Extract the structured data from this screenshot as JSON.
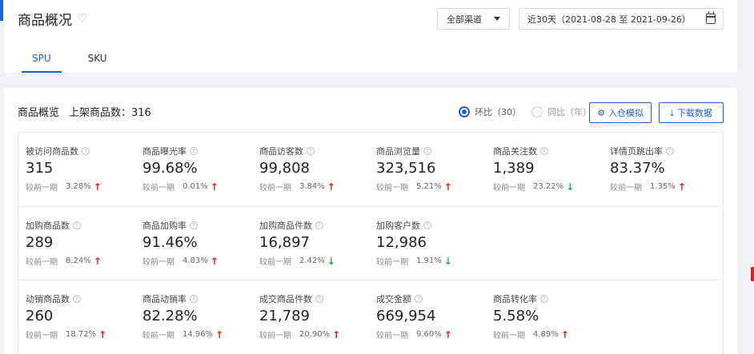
{
  "page": {
    "title": "商品概况"
  },
  "filters": {
    "channel": "全部渠道",
    "date_range": "近30天（2021-08-28 至 2021-09-26）"
  },
  "tabs": [
    {
      "label": "SPU",
      "active": true
    },
    {
      "label": "SKU",
      "active": false
    }
  ],
  "overview": {
    "title": "商品概览",
    "listed_label": "上架商品数：316",
    "radio_mom": "环比（30）",
    "radio_yoy": "同比（年）",
    "simulate_button": "入仓模拟",
    "download_button": "下载数据",
    "compare_label": "较前一期"
  },
  "colors": {
    "accent": "#1d5fd6",
    "up": "#e02020",
    "down": "#1ea649"
  },
  "metrics": [
    [
      {
        "label": "被访问商品数",
        "value": "315",
        "pct": "3.28%",
        "trend": "up"
      },
      {
        "label": "商品曝光率",
        "value": "99.68%",
        "pct": "0.01%",
        "trend": "up"
      },
      {
        "label": "商品访客数",
        "value": "99,808",
        "pct": "3.84%",
        "trend": "up"
      },
      {
        "label": "商品浏览量",
        "value": "323,516",
        "pct": "5.21%",
        "trend": "up"
      },
      {
        "label": "商品关注数",
        "value": "1,389",
        "pct": "23.22%",
        "trend": "down"
      },
      {
        "label": "详情页跳出率",
        "value": "83.37%",
        "pct": "1.35%",
        "trend": "up"
      }
    ],
    [
      {
        "label": "加购商品数",
        "value": "289",
        "pct": "8.24%",
        "trend": "up"
      },
      {
        "label": "商品加购率",
        "value": "91.46%",
        "pct": "4.83%",
        "trend": "up"
      },
      {
        "label": "加购商品件数",
        "value": "16,897",
        "pct": "2.42%",
        "trend": "down"
      },
      {
        "label": "加购客户数",
        "value": "12,986",
        "pct": "1.91%",
        "trend": "down"
      }
    ],
    [
      {
        "label": "动销商品数",
        "value": "260",
        "pct": "18.72%",
        "trend": "up"
      },
      {
        "label": "商品动销率",
        "value": "82.28%",
        "pct": "14.96%",
        "trend": "up"
      },
      {
        "label": "成交商品件数",
        "value": "21,789",
        "pct": "20.90%",
        "trend": "up"
      },
      {
        "label": "成交金额",
        "value": "669,954",
        "pct": "9.60%",
        "trend": "up"
      },
      {
        "label": "商品转化率",
        "value": "5.58%",
        "pct": "4.89%",
        "trend": "up"
      }
    ]
  ]
}
